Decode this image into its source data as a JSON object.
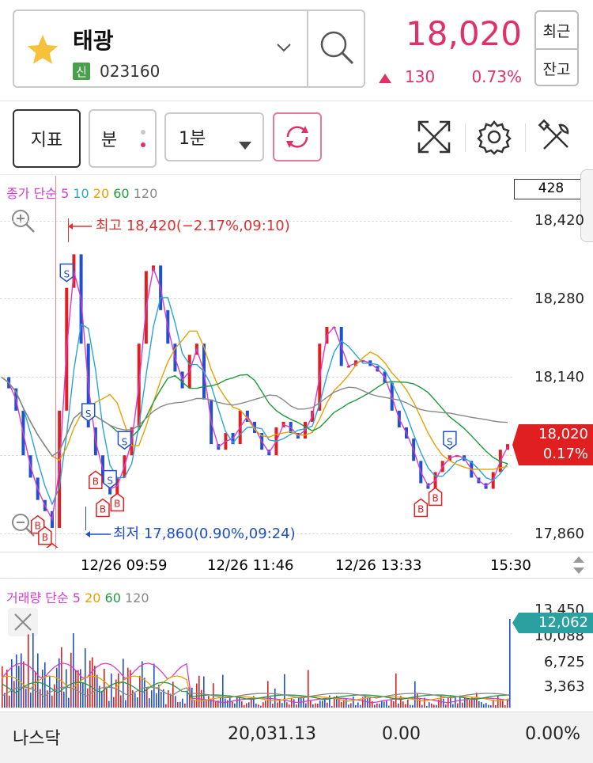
{
  "header": {
    "stock_name": "태광",
    "market_badge": "신",
    "stock_code": "023160",
    "price": "18,020",
    "change": "130",
    "change_pct": "0.73%",
    "btn_recent": "최근",
    "btn_balance": "잔고",
    "favorite_icon": "star-icon",
    "dropdown_icon": "chevron-down-icon",
    "search_icon": "search-icon"
  },
  "toolbar": {
    "indicator_label": "지표",
    "period_label": "분",
    "interval_value": "1분",
    "icons": [
      "refresh-icon",
      "fullscreen-icon",
      "gear-icon",
      "tools-icon"
    ]
  },
  "price_chart": {
    "legend_prefix": "종가 단순",
    "ma_labels": [
      "5",
      "10",
      "20",
      "60",
      "120"
    ],
    "ma_colors": [
      "#d63ad0",
      "#2aa4d6",
      "#e6a200",
      "#1e9a3c",
      "#888888"
    ],
    "count_box": "428",
    "y_ticks": [
      "18,420",
      "18,280",
      "18,140",
      "17,860"
    ],
    "current_price_tag": "18,020",
    "current_pct_tag": "0.17%",
    "high_annotation": "최고 18,420(−2.17%,09:10)",
    "low_annotation": "최저 17,860(0.90%,09:24)",
    "x_ticks": [
      "12/26 09:59",
      "12/26 11:46",
      "12/26 13:33",
      "15:30"
    ],
    "zoom_in_icon": "zoom-in-icon",
    "zoom_out_icon": "zoom-out-icon"
  },
  "volume_chart": {
    "legend_prefix": "거래량 단순",
    "ma_labels": [
      "5",
      "20",
      "60",
      "120"
    ],
    "ma_colors": [
      "#d63ad0",
      "#e6a200",
      "#1e9a3c",
      "#888888"
    ],
    "y_ticks": [
      "13,450",
      "10,088",
      "6,725",
      "3,363"
    ],
    "current_volume_tag": "12,062",
    "close_icon": "close-icon"
  },
  "footer": {
    "index_name": "나스닥",
    "index_value": "20,031.13",
    "index_change": "0.00",
    "index_pct": "0.00%"
  },
  "chart_data": {
    "type": "candlestick",
    "title": "",
    "ylim": [
      17860,
      18420
    ],
    "x_labels": [
      "12/26 09:59",
      "12/26 11:46",
      "12/26 13:33",
      "15:30"
    ],
    "high": {
      "value": 18420,
      "time": "09:10"
    },
    "low": {
      "value": 17860,
      "time": "09:24"
    },
    "last": 18020,
    "close_series": [
      18140,
      18120,
      18080,
      18000,
      17960,
      17920,
      17900,
      17870,
      18080,
      18300,
      18360,
      18200,
      18050,
      18000,
      17950,
      17930,
      17960,
      18000,
      18050,
      18200,
      18330,
      18340,
      18260,
      18200,
      18150,
      18120,
      18180,
      18200,
      18100,
      18020,
      18010,
      18040,
      18020,
      18080,
      18060,
      18040,
      18010,
      18000,
      18050,
      18060,
      18040,
      18030,
      18060,
      18080,
      18200,
      18230,
      18230,
      18160,
      18160,
      18170,
      18170,
      18160,
      18150,
      18130,
      18080,
      18050,
      18030,
      17990,
      17950,
      17940,
      17970,
      17990,
      18000,
      18000,
      17990,
      17960,
      17950,
      17940,
      17970,
      18010,
      18020
    ]
  }
}
